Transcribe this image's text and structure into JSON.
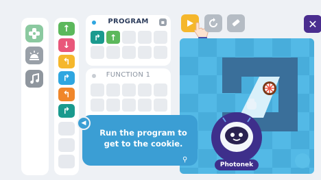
{
  "categories": [
    {
      "name": "motion",
      "icon": "gamepad-icon",
      "color": "#8bc9a0"
    },
    {
      "name": "lights",
      "icon": "light-icon",
      "color": "#99a0a8"
    },
    {
      "name": "sound",
      "icon": "music-note-icon",
      "color": "#8f969e"
    }
  ],
  "commands": [
    {
      "icon": "arrow-up-icon",
      "glyph": "↑",
      "color": "#5cb85c"
    },
    {
      "icon": "arrow-down-icon",
      "glyph": "↓",
      "color": "#e9577a"
    },
    {
      "icon": "turn-left-icon",
      "glyph": "↰",
      "color": "#f5b72c"
    },
    {
      "icon": "turn-right-icon",
      "glyph": "↱",
      "color": "#2fa6e0"
    },
    {
      "icon": "turn-left-orange-icon",
      "glyph": "↰",
      "color": "#f0862a"
    },
    {
      "icon": "turn-right-teal-icon",
      "glyph": "↱",
      "color": "#1a9a8e"
    }
  ],
  "program": {
    "title": "PROGRAM",
    "dot_color": "#2fa6e0",
    "blocks": [
      {
        "glyph": "↱",
        "color": "#1a9a8e"
      },
      {
        "glyph": "↑",
        "color": "#5cb85c"
      }
    ]
  },
  "function1": {
    "title": "FUNCTION 1"
  },
  "toolbar": {
    "play_color": "#f5b72c",
    "reset_color": "#b5bcc4",
    "eraser_color": "#b5bcc4",
    "close_label": "✕"
  },
  "hint": {
    "text": "Run the program to get to the cookie."
  },
  "robot": {
    "name": "Photonek"
  }
}
